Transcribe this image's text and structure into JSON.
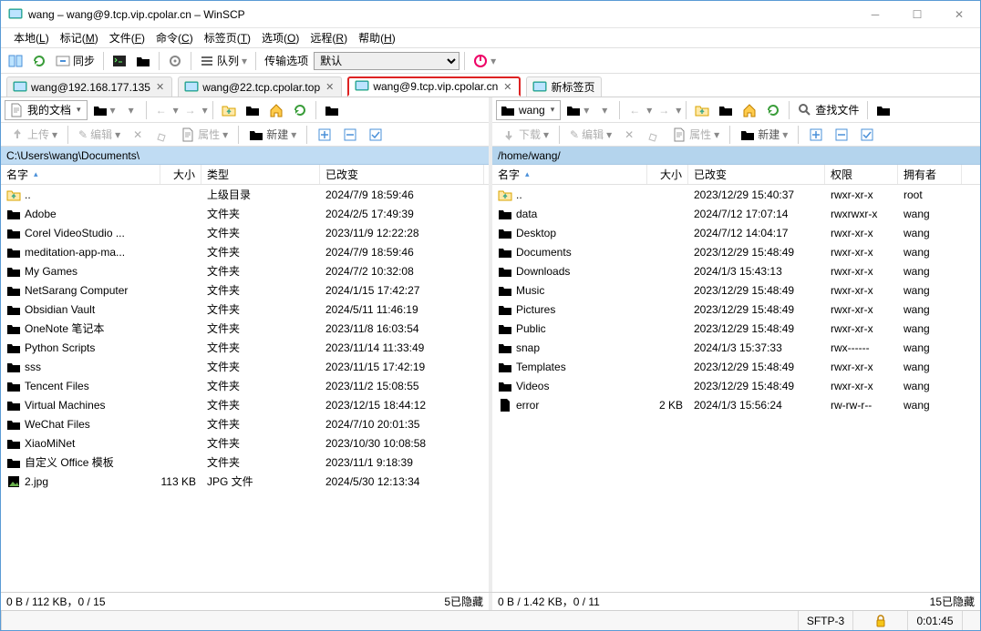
{
  "window": {
    "title": "wang – wang@9.tcp.vip.cpolar.cn – WinSCP"
  },
  "menubar": [
    {
      "t": "本地",
      "h": "L"
    },
    {
      "t": "标记",
      "h": "M"
    },
    {
      "t": "文件",
      "h": "F"
    },
    {
      "t": "命令",
      "h": "C"
    },
    {
      "t": "标签页",
      "h": "T"
    },
    {
      "t": "选项",
      "h": "O"
    },
    {
      "t": "远程",
      "h": "R"
    },
    {
      "t": "帮助",
      "h": "H"
    }
  ],
  "toolbar1": {
    "sync": "同步",
    "queue": "队列",
    "transfer_label": "传输选项",
    "transfer_value": "默认"
  },
  "session_tabs": [
    {
      "label": "wang@192.168.177.135",
      "active": false
    },
    {
      "label": "wang@22.tcp.cpolar.top",
      "active": false
    },
    {
      "label": "wang@9.tcp.vip.cpolar.cn",
      "active": true
    }
  ],
  "new_tab": "新标签页",
  "local": {
    "combo": "我的文档",
    "path": "C:\\Users\\wang\\Documents\\",
    "actions": {
      "upload": "上传",
      "edit": "编辑",
      "properties": "属性",
      "newmenu": "新建"
    },
    "cols": {
      "name": "名字",
      "sort": "▴",
      "size": "大小",
      "type": "类型",
      "changed": "已改变"
    },
    "widths": {
      "name": 175,
      "size": 45,
      "type": 130,
      "changed": 180
    },
    "rows": [
      {
        "icon": "up",
        "name": "..",
        "size": "",
        "type": "上级目录",
        "changed": "2024/7/9 18:59:46"
      },
      {
        "icon": "folder",
        "name": "Adobe",
        "size": "",
        "type": "文件夹",
        "changed": "2024/2/5 17:49:39"
      },
      {
        "icon": "folder",
        "name": "Corel VideoStudio ...",
        "size": "",
        "type": "文件夹",
        "changed": "2023/11/9 12:22:28"
      },
      {
        "icon": "folder",
        "name": "meditation-app-ma...",
        "size": "",
        "type": "文件夹",
        "changed": "2024/7/9 18:59:46"
      },
      {
        "icon": "folder",
        "name": "My Games",
        "size": "",
        "type": "文件夹",
        "changed": "2024/7/2 10:32:08"
      },
      {
        "icon": "folder",
        "name": "NetSarang Computer",
        "size": "",
        "type": "文件夹",
        "changed": "2024/1/15 17:42:27"
      },
      {
        "icon": "folder",
        "name": "Obsidian Vault",
        "size": "",
        "type": "文件夹",
        "changed": "2024/5/11 11:46:19"
      },
      {
        "icon": "folder",
        "name": "OneNote 笔记本",
        "size": "",
        "type": "文件夹",
        "changed": "2023/11/8 16:03:54"
      },
      {
        "icon": "folder",
        "name": "Python Scripts",
        "size": "",
        "type": "文件夹",
        "changed": "2023/11/14 11:33:49"
      },
      {
        "icon": "folder",
        "name": "sss",
        "size": "",
        "type": "文件夹",
        "changed": "2023/11/15 17:42:19"
      },
      {
        "icon": "folder",
        "name": "Tencent Files",
        "size": "",
        "type": "文件夹",
        "changed": "2023/11/2 15:08:55"
      },
      {
        "icon": "folder",
        "name": "Virtual Machines",
        "size": "",
        "type": "文件夹",
        "changed": "2023/12/15 18:44:12"
      },
      {
        "icon": "folder",
        "name": "WeChat Files",
        "size": "",
        "type": "文件夹",
        "changed": "2024/7/10 20:01:35"
      },
      {
        "icon": "folder",
        "name": "XiaoMiNet",
        "size": "",
        "type": "文件夹",
        "changed": "2023/10/30 10:08:58"
      },
      {
        "icon": "folder",
        "name": "自定义 Office 模板",
        "size": "",
        "type": "文件夹",
        "changed": "2023/11/1 9:18:39"
      },
      {
        "icon": "img",
        "name": "2.jpg",
        "size": "113 KB",
        "type": "JPG 文件",
        "changed": "2024/5/30 12:13:34"
      }
    ],
    "status": {
      "left": "0 B / 112 KB，0 / 15",
      "right": "5已隐藏"
    }
  },
  "remote": {
    "combo": "wang",
    "find": "查找文件",
    "path": "/home/wang/",
    "actions": {
      "download": "下载",
      "edit": "编辑",
      "properties": "属性",
      "newmenu": "新建"
    },
    "cols": {
      "name": "名字",
      "sort": "▴",
      "size": "大小",
      "changed": "已改变",
      "perm": "权限",
      "owner": "拥有者"
    },
    "widths": {
      "name": 170,
      "size": 45,
      "changed": 150,
      "perm": 80,
      "owner": 70
    },
    "rows": [
      {
        "icon": "up",
        "name": "..",
        "size": "",
        "changed": "2023/12/29 15:40:37",
        "perm": "rwxr-xr-x",
        "owner": "root"
      },
      {
        "icon": "folder",
        "name": "data",
        "size": "",
        "changed": "2024/7/12 17:07:14",
        "perm": "rwxrwxr-x",
        "owner": "wang"
      },
      {
        "icon": "folder",
        "name": "Desktop",
        "size": "",
        "changed": "2024/7/12 14:04:17",
        "perm": "rwxr-xr-x",
        "owner": "wang"
      },
      {
        "icon": "folder",
        "name": "Documents",
        "size": "",
        "changed": "2023/12/29 15:48:49",
        "perm": "rwxr-xr-x",
        "owner": "wang"
      },
      {
        "icon": "folder",
        "name": "Downloads",
        "size": "",
        "changed": "2024/1/3 15:43:13",
        "perm": "rwxr-xr-x",
        "owner": "wang"
      },
      {
        "icon": "folder",
        "name": "Music",
        "size": "",
        "changed": "2023/12/29 15:48:49",
        "perm": "rwxr-xr-x",
        "owner": "wang"
      },
      {
        "icon": "folder",
        "name": "Pictures",
        "size": "",
        "changed": "2023/12/29 15:48:49",
        "perm": "rwxr-xr-x",
        "owner": "wang"
      },
      {
        "icon": "folder",
        "name": "Public",
        "size": "",
        "changed": "2023/12/29 15:48:49",
        "perm": "rwxr-xr-x",
        "owner": "wang"
      },
      {
        "icon": "folder",
        "name": "snap",
        "size": "",
        "changed": "2024/1/3 15:37:33",
        "perm": "rwx------",
        "owner": "wang"
      },
      {
        "icon": "folder",
        "name": "Templates",
        "size": "",
        "changed": "2023/12/29 15:48:49",
        "perm": "rwxr-xr-x",
        "owner": "wang"
      },
      {
        "icon": "folder",
        "name": "Videos",
        "size": "",
        "changed": "2023/12/29 15:48:49",
        "perm": "rwxr-xr-x",
        "owner": "wang"
      },
      {
        "icon": "file",
        "name": "error",
        "size": "2 KB",
        "changed": "2024/1/3 15:56:24",
        "perm": "rw-rw-r--",
        "owner": "wang"
      }
    ],
    "status": {
      "left": "0 B / 1.42 KB，0 / 11",
      "right": "15已隐藏"
    }
  },
  "connection": {
    "protocol": "SFTP-3",
    "time": "0:01:45"
  }
}
